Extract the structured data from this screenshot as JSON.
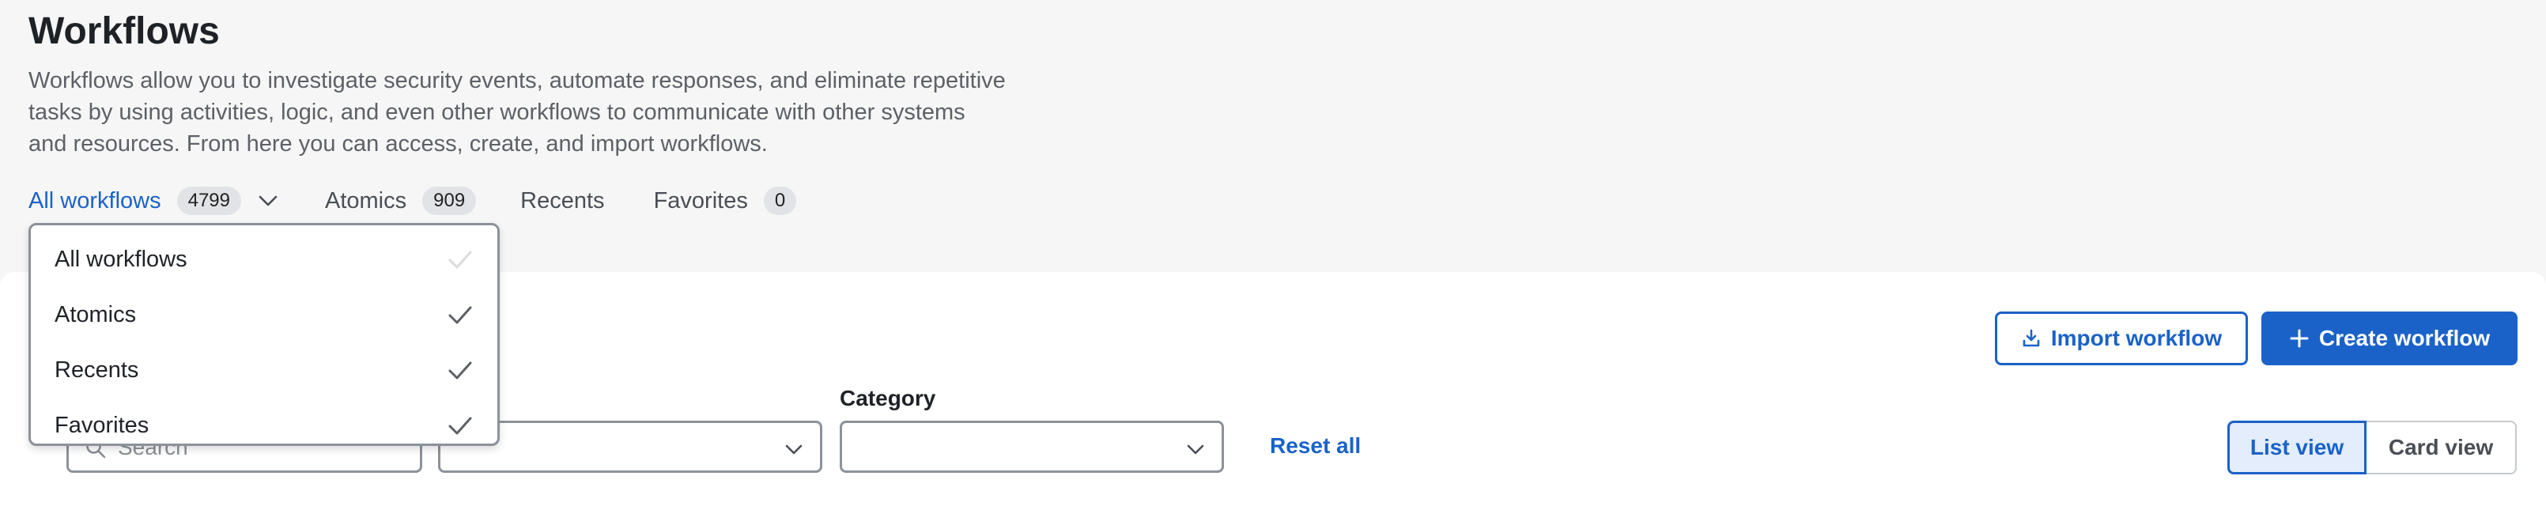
{
  "header": {
    "title": "Workflows",
    "description": "Workflows allow you to investigate security events, automate responses, and eliminate repetitive tasks by using activities, logic, and even other workflows to communicate with other systems and resources. From here you can access, create, and import workflows."
  },
  "tabs": [
    {
      "label": "All workflows",
      "count": "4799",
      "active": true
    },
    {
      "label": "Atomics",
      "count": "909"
    },
    {
      "label": "Recents"
    },
    {
      "label": "Favorites",
      "count": "0"
    }
  ],
  "dropdown": {
    "items": [
      {
        "label": "All workflows",
        "checked": true,
        "check_state": "disabled"
      },
      {
        "label": "Atomics",
        "checked": true
      },
      {
        "label": "Recents",
        "checked": true
      },
      {
        "label": "Favorites",
        "checked": true
      }
    ]
  },
  "actions": {
    "import_label": "Import workflow",
    "create_label": "Create workflow"
  },
  "filters": {
    "search_placeholder": "Search",
    "second_label_partial": "s",
    "category_label": "Category",
    "reset_label": "Reset all"
  },
  "view_toggle": {
    "list_label": "List view",
    "card_label": "Card view",
    "selected": "List view"
  },
  "colors": {
    "accent": "#1a62c8",
    "page_bg": "#f6f6f6",
    "panel_bg": "#ffffff",
    "badge_bg": "#e1e3e6"
  }
}
